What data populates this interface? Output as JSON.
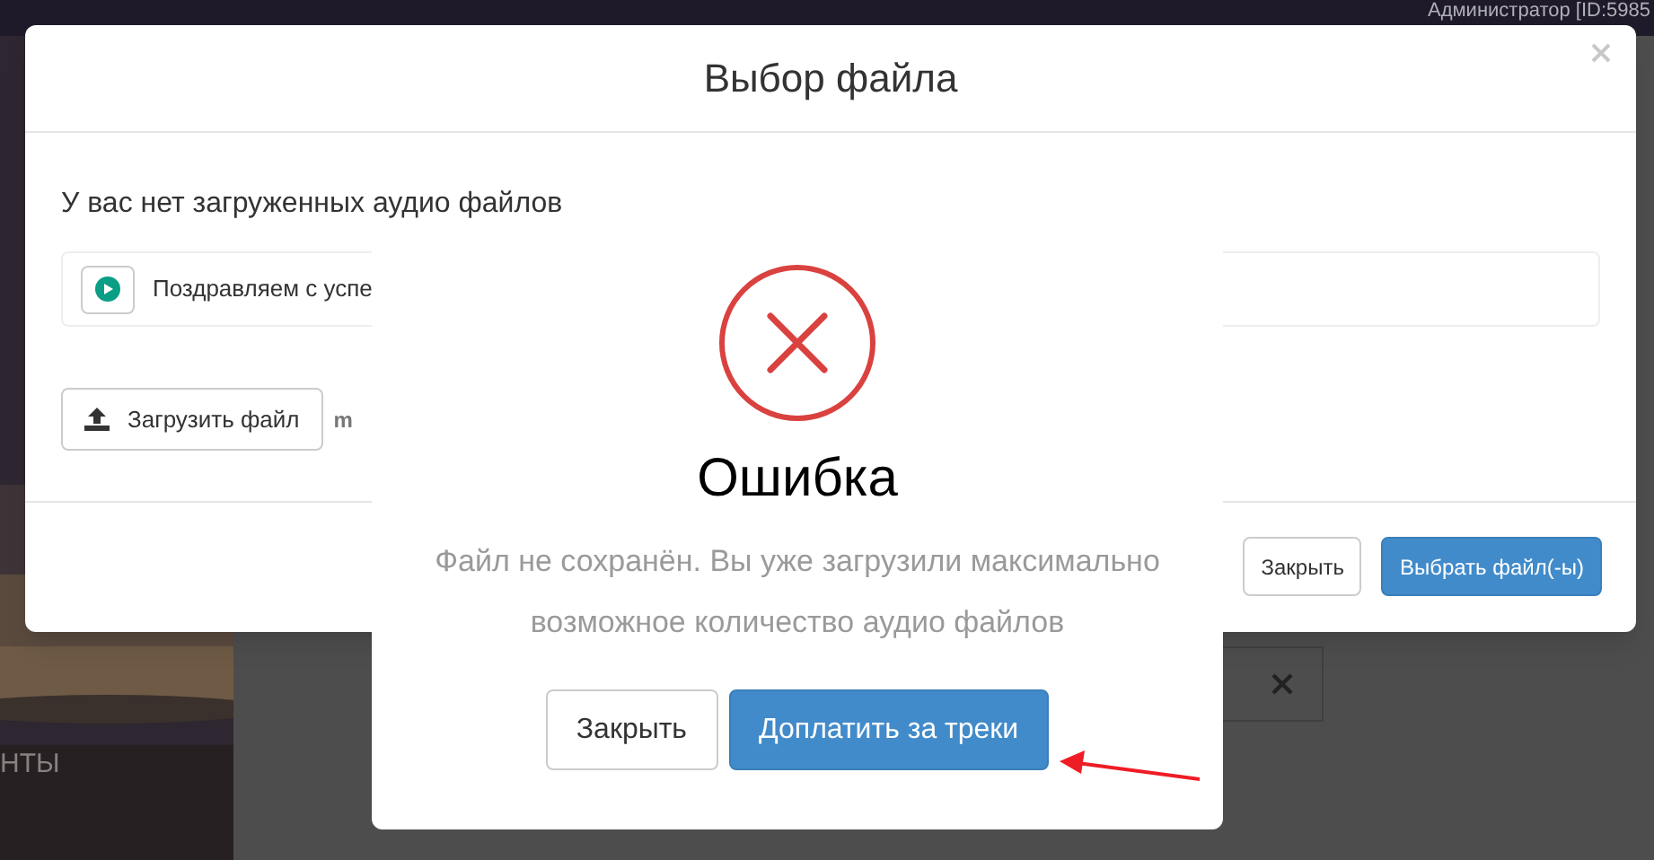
{
  "background": {
    "user_label": "Администратор [ID:5985",
    "sidebar_label": "НТЫ"
  },
  "file_dialog": {
    "title": "Выбор файла",
    "notice": "У вас нет загруженных аудио файлов",
    "track": {
      "title": "Поздравляем с успе"
    },
    "upload_button": "Загрузить файл",
    "format_hint": "m",
    "buttons": [
      {
        "label": "Закрыть",
        "kind": "secondary"
      },
      {
        "label": "Выбрать файл(-ы)",
        "kind": "primary"
      }
    ]
  },
  "error_dialog": {
    "title": "Ошибка",
    "message": "Файл не сохранён. Вы уже загрузили максимально возможное количество аудио файлов",
    "buttons": [
      {
        "label": "Закрыть",
        "kind": "secondary"
      },
      {
        "label": "Доплатить за треки",
        "kind": "primary"
      }
    ]
  }
}
